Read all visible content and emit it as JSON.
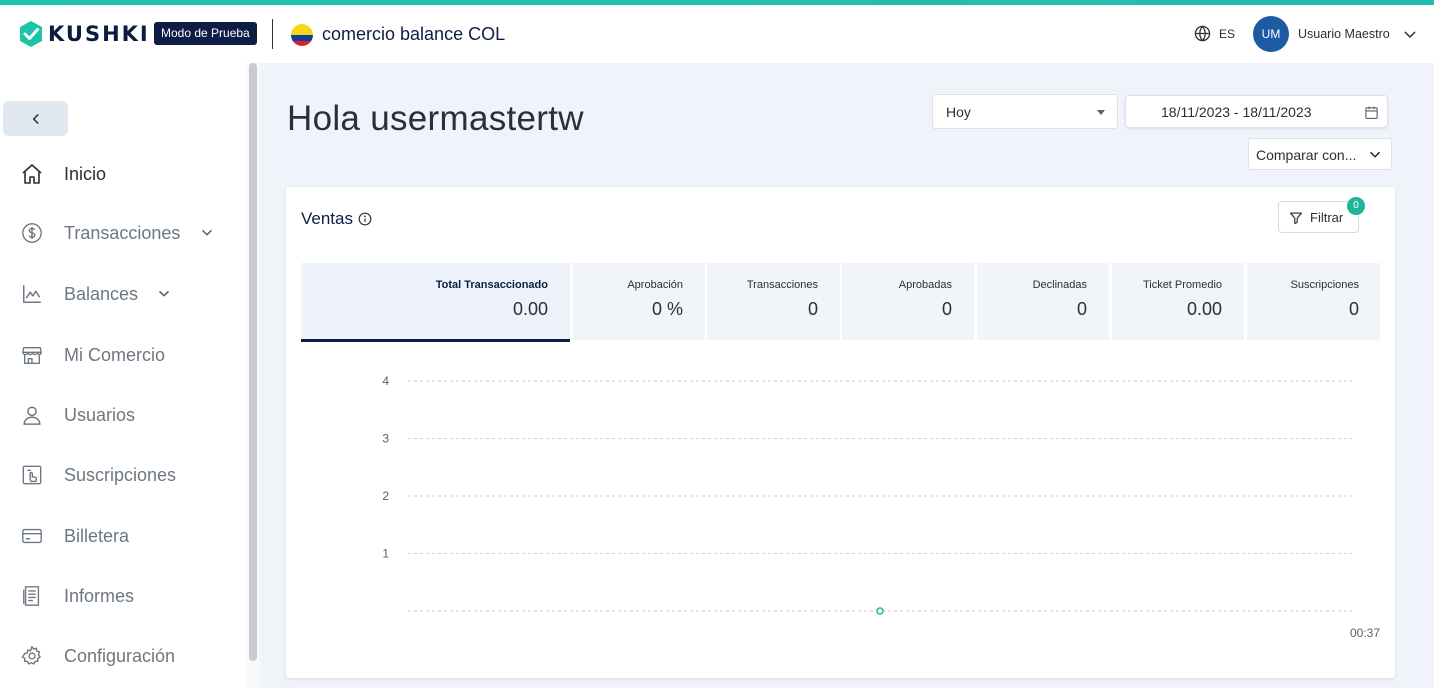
{
  "header": {
    "brand": "KUSHKI",
    "mode_badge": "Modo de Prueba",
    "merchant_name": "comercio balance COL",
    "language": "ES",
    "avatar_initials": "UM",
    "user_name": "Usuario Maestro"
  },
  "sidebar": {
    "items": [
      {
        "label": "Inicio",
        "icon": "home-icon"
      },
      {
        "label": "Transacciones",
        "icon": "dollar-circle-icon"
      },
      {
        "label": "Balances",
        "icon": "line-chart-icon"
      },
      {
        "label": "Mi Comercio",
        "icon": "storefront-icon"
      },
      {
        "label": "Usuarios",
        "icon": "user-icon"
      },
      {
        "label": "Suscripciones",
        "icon": "subscription-icon"
      },
      {
        "label": "Billetera",
        "icon": "wallet-card-icon"
      },
      {
        "label": "Informes",
        "icon": "report-icon"
      },
      {
        "label": "Configuración",
        "icon": "gear-icon"
      }
    ]
  },
  "main": {
    "greeting": "Hola usermastertw",
    "period_value": "Hoy",
    "date_range": "18/11/2023 - 18/11/2023",
    "compare_label": "Comparar con..."
  },
  "sales_card": {
    "title": "Ventas",
    "filter_label": "Filtrar",
    "filter_count": "0",
    "metrics": [
      {
        "label": "Total Transaccionado",
        "value": "0.00"
      },
      {
        "label": "Aprobación",
        "value": "0 %"
      },
      {
        "label": "Transacciones",
        "value": "0"
      },
      {
        "label": "Aprobadas",
        "value": "0"
      },
      {
        "label": "Declinadas",
        "value": "0"
      },
      {
        "label": "Ticket Promedio",
        "value": "0.00"
      },
      {
        "label": "Suscripciones",
        "value": "0"
      }
    ]
  },
  "colors": {
    "accent_teal": "#1fb59c",
    "navy": "#0d1d45",
    "avatar_blue": "#1c5aa3"
  },
  "chart_data": {
    "type": "line",
    "y_ticks": [
      "4",
      "3",
      "2",
      "1"
    ],
    "ylim": [
      0,
      4
    ],
    "x_labels": [
      "00:37"
    ],
    "series": [
      {
        "values": [
          {
            "x": "00:37",
            "y": 0
          }
        ]
      }
    ],
    "grid": true,
    "title": "",
    "xlabel": "",
    "ylabel": ""
  }
}
